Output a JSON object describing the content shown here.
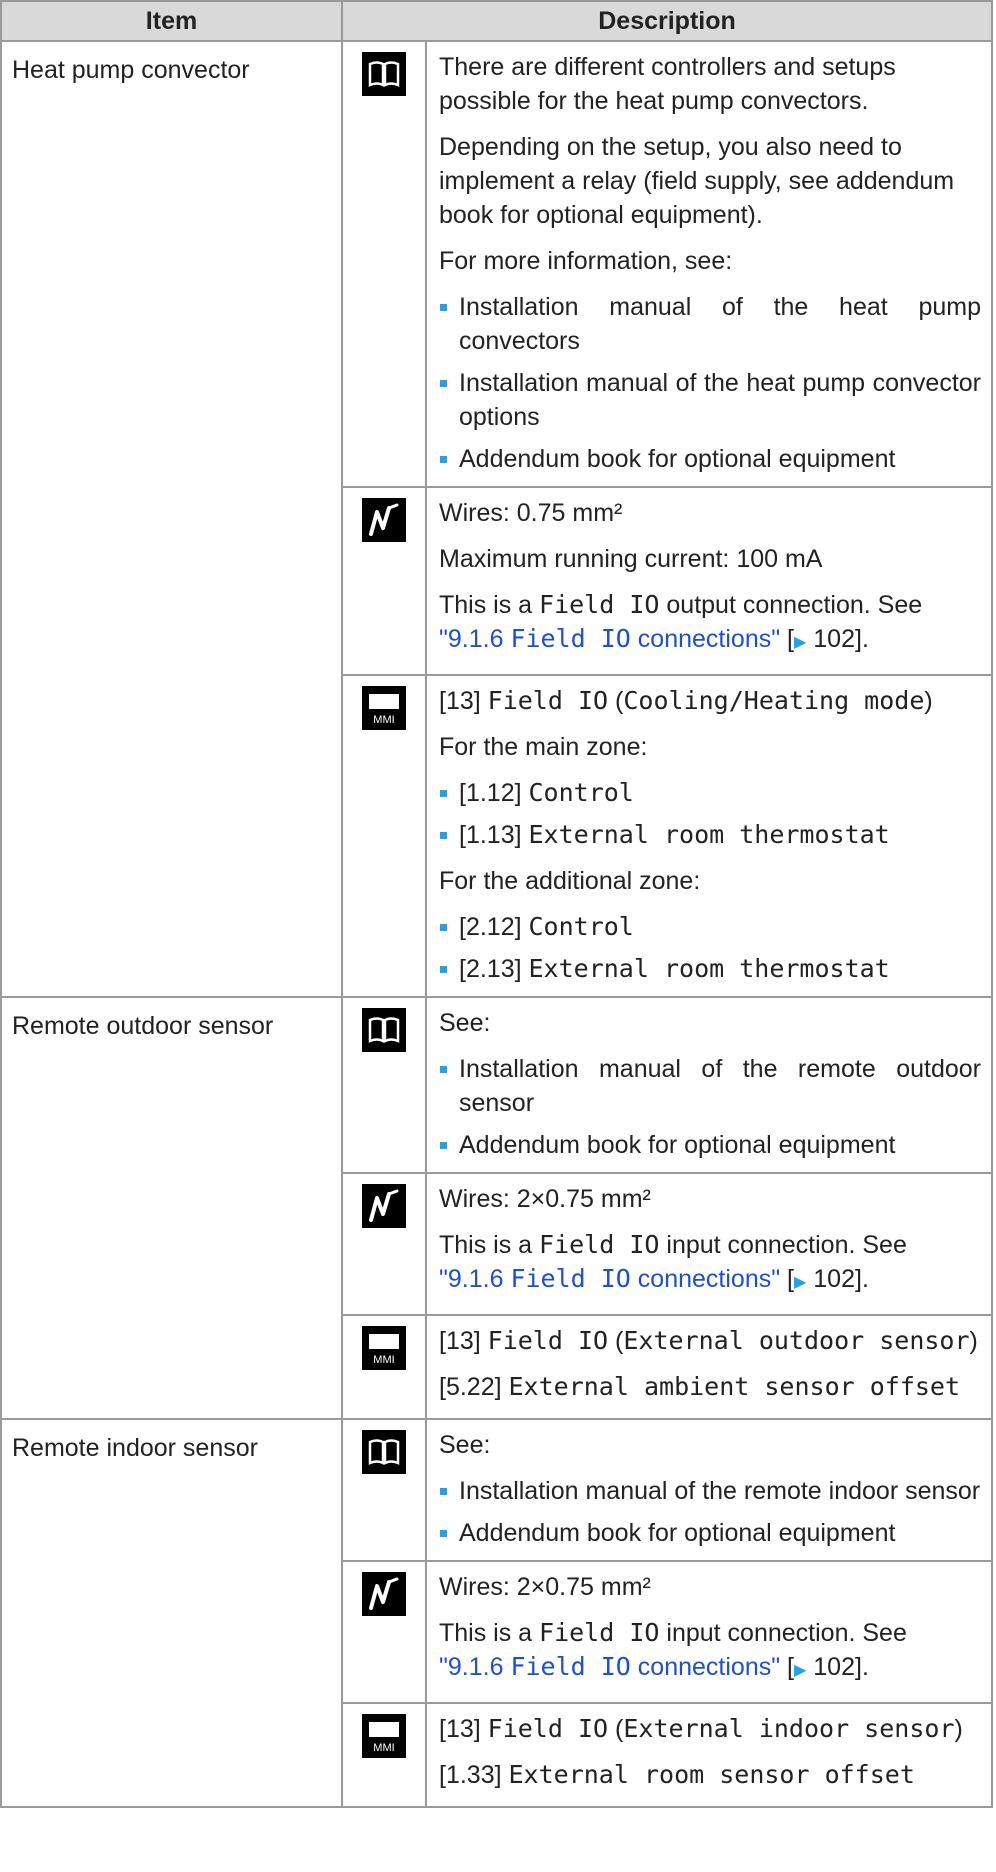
{
  "header": {
    "item": "Item",
    "description": "Description"
  },
  "rows": {
    "convector": {
      "name": "Heat pump convector",
      "book_p1": "There are different controllers and setups possible for the heat pump convectors.",
      "book_p2": "Depending on the setup, you also need to implement a relay (field supply, see addendum book for optional equipment).",
      "book_p3": "For more information, see:",
      "book_b1": "Installation manual of the heat pump convectors",
      "book_b2": "Installation manual of the heat pump convector options",
      "book_b3": "Addendum book for optional equipment",
      "wire_p1": "Wires: 0.75 mm²",
      "wire_p2": "Maximum running current: 100 mA",
      "wire_p3_pre": "This is a ",
      "wire_p3_code": "Field IO",
      "wire_p3_post": " output connection. See",
      "link_num": "\"9.1.6 ",
      "link_code": "Field IO",
      "link_post": " connections\"",
      "link_page": "102",
      "mmi_p1_pre": "[13] ",
      "mmi_p1_code": "Field IO",
      "mmi_p1_sub": "Cooling/Heating mode",
      "mmi_main": "For the main zone:",
      "mmi_b1_pre": "[1.12] ",
      "mmi_b1_code": "Control",
      "mmi_b2_pre": "[1.13] ",
      "mmi_b2_code": "External room thermostat",
      "mmi_add": "For the additional zone:",
      "mmi_b3_pre": "[2.12] ",
      "mmi_b3_code": "Control",
      "mmi_b4_pre": "[2.13] ",
      "mmi_b4_code": "External room thermostat"
    },
    "outdoor": {
      "name": "Remote outdoor sensor",
      "book_p1": "See:",
      "book_b1": "Installation manual of the remote outdoor sensor",
      "book_b2": "Addendum book for optional equipment",
      "wire_p1": "Wires: 2×0.75 mm²",
      "wire_p3_pre": "This is a ",
      "wire_p3_code": "Field IO",
      "wire_p3_post": " input connection. See",
      "link_num": "\"9.1.6 ",
      "link_code": "Field IO",
      "link_post": " connections\"",
      "link_page": "102",
      "mmi_p1_pre": "[13] ",
      "mmi_p1_code": "Field IO",
      "mmi_p1_sub": "External outdoor sensor",
      "mmi_p2_pre": "[5.22] ",
      "mmi_p2_code": "External ambient sensor offset"
    },
    "indoor": {
      "name": "Remote indoor sensor",
      "book_p1": "See:",
      "book_b1": "Installation manual of the remote indoor sensor",
      "book_b2": "Addendum book for optional equipment",
      "wire_p1": "Wires: 2×0.75 mm²",
      "wire_p3_pre": "This is a ",
      "wire_p3_code": "Field IO",
      "wire_p3_post": " input connection. See",
      "link_num": "\"9.1.6 ",
      "link_code": "Field IO",
      "link_post": " connections\"",
      "link_page": "102",
      "mmi_p1_pre": "[13] ",
      "mmi_p1_code": "Field IO",
      "mmi_p1_sub": "External indoor sensor",
      "mmi_p2_pre": "[1.33] ",
      "mmi_p2_code": "External room sensor offset"
    }
  },
  "icons": {
    "book": "book-icon",
    "wire": "wiring-icon",
    "mmi": "mmi-icon",
    "mmi_label": "MMI",
    "page_arrow": "▶"
  },
  "colors": {
    "header_bg": "#d9d9d9",
    "bullet": "#1da1f2",
    "link": "#1b4fd8",
    "border": "#9a9a9a"
  }
}
